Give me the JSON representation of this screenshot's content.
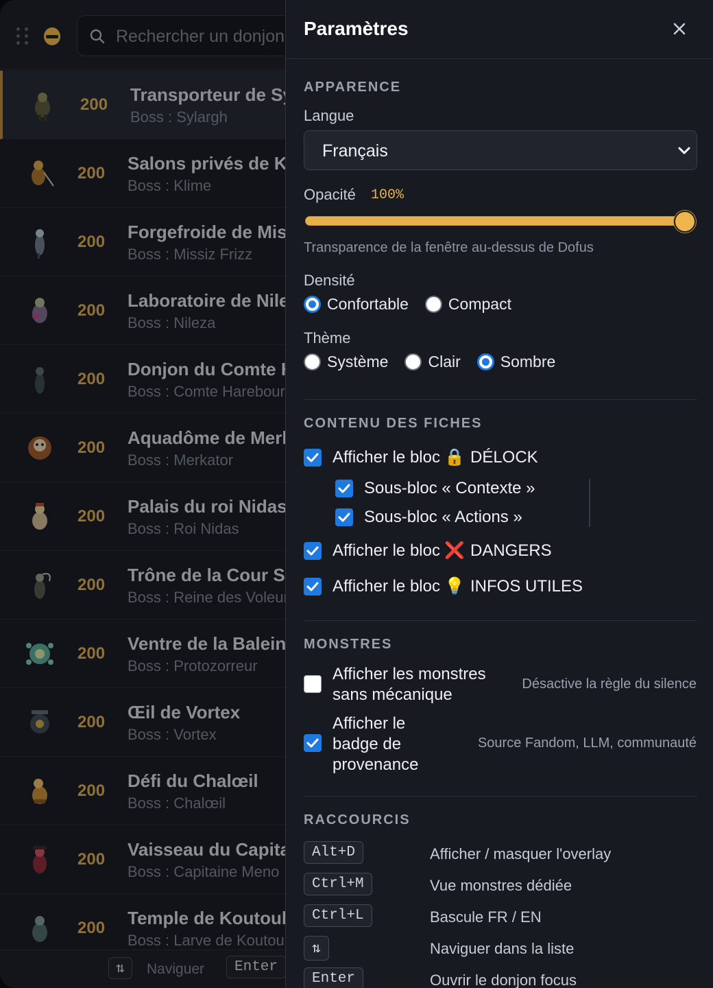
{
  "search": {
    "placeholder": "Rechercher un donjon"
  },
  "dungeons": [
    {
      "level": "200",
      "name": "Transporteur de Sylargh",
      "boss": "Boss : Sylargh"
    },
    {
      "level": "200",
      "name": "Salons privés de Klime",
      "boss": "Boss : Klime"
    },
    {
      "level": "200",
      "name": "Forgefroide de Missiz Frizz",
      "boss": "Boss : Missiz Frizz"
    },
    {
      "level": "200",
      "name": "Laboratoire de Nileza",
      "boss": "Boss : Nileza"
    },
    {
      "level": "200",
      "name": "Donjon du Comte Harebourg",
      "boss": "Boss : Comte Harebourg"
    },
    {
      "level": "200",
      "name": "Aquadôme de Merkator",
      "boss": "Boss : Merkator"
    },
    {
      "level": "200",
      "name": "Palais du roi Nidas",
      "boss": "Boss : Roi Nidas"
    },
    {
      "level": "200",
      "name": "Trône de la Cour Sombre",
      "boss": "Boss : Reine des Voleurs"
    },
    {
      "level": "200",
      "name": "Ventre de la Baleine",
      "boss": "Boss : Protozorreur"
    },
    {
      "level": "200",
      "name": "Œil de Vortex",
      "boss": "Boss : Vortex"
    },
    {
      "level": "200",
      "name": "Défi du Chalœil",
      "boss": "Boss : Chalœil"
    },
    {
      "level": "200",
      "name": "Vaisseau du Capitaine Meno",
      "boss": "Boss : Capitaine Meno"
    },
    {
      "level": "200",
      "name": "Temple de Koutoulou",
      "boss": "Boss : Larve de Koutoulou"
    }
  ],
  "footer": {
    "nav_key": "⇅",
    "nav_label": "Naviguer",
    "enter_key": "Enter"
  },
  "settings": {
    "title": "Paramètres",
    "appearance": {
      "section": "APPARENCE",
      "language_label": "Langue",
      "language_value": "Français",
      "opacity_label": "Opacité",
      "opacity_value": "100%",
      "opacity_level": 1.0,
      "opacity_hint": "Transparence de la fenêtre au-dessus de Dofus",
      "density_label": "Densité",
      "density_options": [
        "Confortable",
        "Compact"
      ],
      "density_selected": "Confortable",
      "theme_label": "Thème",
      "theme_options": [
        "Système",
        "Clair",
        "Sombre"
      ],
      "theme_selected": "Sombre"
    },
    "content": {
      "section": "CONTENU DES FICHES",
      "delock_prefix": "Afficher le bloc",
      "delock_emoji": "🔒",
      "delock_name": "DÉLOCK",
      "sub_context": "Sous-bloc « Contexte »",
      "sub_actions": "Sous-bloc « Actions »",
      "dangers_prefix": "Afficher le bloc",
      "dangers_emoji": "❌",
      "dangers_name": "DANGERS",
      "infos_prefix": "Afficher le bloc",
      "infos_emoji": "💡",
      "infos_name": "INFOS UTILES"
    },
    "monsters": {
      "section": "MONSTRES",
      "no_mechanic_label": "Afficher les monstres sans mécanique",
      "no_mechanic_desc": "Désactive la règle du silence",
      "badge_label": "Afficher le badge de provenance",
      "badge_desc": "Source Fandom, LLM, communauté"
    },
    "shortcuts": {
      "section": "RACCOURCIS",
      "items": [
        {
          "key": "Alt+D",
          "label": "Afficher / masquer l'overlay"
        },
        {
          "key": "Ctrl+M",
          "label": "Vue monstres dédiée"
        },
        {
          "key": "Ctrl+L",
          "label": "Bascule FR / EN"
        },
        {
          "key": "⇅",
          "label": "Naviguer dans la liste"
        },
        {
          "key": "Enter",
          "label": "Ouvrir le donjon focus"
        }
      ]
    }
  },
  "colors": {
    "accent": "#e8b04a",
    "primary": "#1f7ae0",
    "panel_bg": "#171a21"
  }
}
